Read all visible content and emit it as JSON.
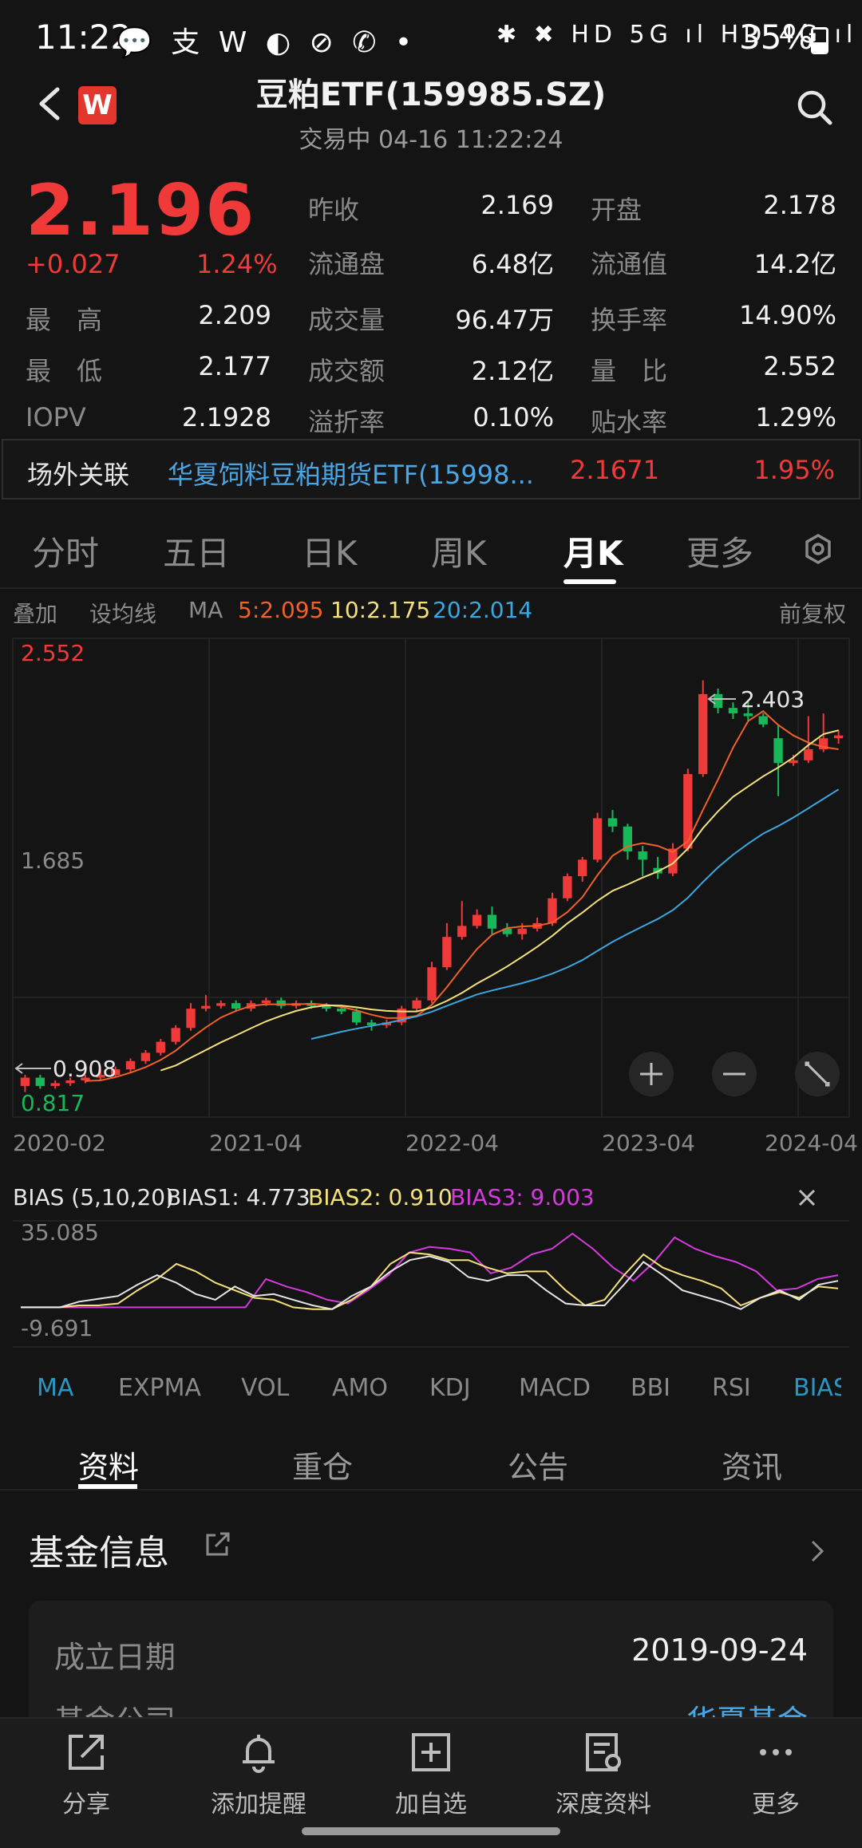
{
  "status_bar": {
    "time": "11:22",
    "left_icons": "💬 支 W ◐ ⊘ ✆ •",
    "right_icons": "✱ ✖ HD 5G ıl HD 4G ıl",
    "battery": "35%"
  },
  "header": {
    "logo_text": "W",
    "title": "豆粕ETF(159985.SZ)",
    "subtitle": "交易中 04-16 11:22:24"
  },
  "quote": {
    "price": "2.196",
    "change": "+0.027",
    "change_pct": "1.24%",
    "left_stats": [
      {
        "label": "最　高",
        "value": "2.209"
      },
      {
        "label": "最　低",
        "value": "2.177"
      },
      {
        "label": "IOPV",
        "value": "2.1928"
      }
    ],
    "mid_stats": [
      {
        "label": "昨收",
        "value": "2.169"
      },
      {
        "label": "流通盘",
        "value": "6.48亿"
      },
      {
        "label": "成交量",
        "value": "96.47万"
      },
      {
        "label": "成交额",
        "value": "2.12亿"
      },
      {
        "label": "溢折率",
        "value": "0.10%"
      }
    ],
    "right_stats": [
      {
        "label": "开盘",
        "value": "2.178"
      },
      {
        "label": "流通值",
        "value": "14.2亿"
      },
      {
        "label": "换手率",
        "value": "14.90%"
      },
      {
        "label": "量　比",
        "value": "2.552"
      },
      {
        "label": "贴水率",
        "value": "1.29%"
      }
    ]
  },
  "related": {
    "label": "场外关联",
    "name": "华夏饲料豆粕期货ETF(15998...",
    "price": "2.1671",
    "pct": "1.95%"
  },
  "period_tabs": [
    "分时",
    "五日",
    "日K",
    "周K",
    "月K",
    "更多"
  ],
  "period_active": "月K",
  "ma_row": {
    "overlay": "叠加",
    "set_ma": "设均线",
    "ma_label": "MA",
    "ma5": "5:2.095",
    "ma10": "10:2.175",
    "ma20": "20:2.014",
    "adjust": "前复权"
  },
  "chart_data": [
    {
      "type": "candlestick",
      "title": "",
      "ylim": [
        0.817,
        2.552
      ],
      "axis_labels": {
        "top": "2.552",
        "mid": "1.685",
        "bottom": "0.817"
      },
      "x_tick_labels": [
        "2020-02",
        "2021-04",
        "2022-04",
        "2023-04",
        "2024-04"
      ],
      "annotations": {
        "high": "2.403",
        "low": "0.908"
      },
      "colors": {
        "up": "#f03a3a",
        "down": "#18b85a",
        "ma5": "#f0602a",
        "ma10": "#f4e17a",
        "ma20": "#3aa8e0"
      },
      "candles": [
        {
          "o": 0.93,
          "c": 0.96,
          "h": 0.97,
          "l": 0.908
        },
        {
          "o": 0.96,
          "c": 0.93,
          "h": 0.97,
          "l": 0.92
        },
        {
          "o": 0.93,
          "c": 0.94,
          "h": 0.95,
          "l": 0.92
        },
        {
          "o": 0.94,
          "c": 0.95,
          "h": 0.96,
          "l": 0.93
        },
        {
          "o": 0.95,
          "c": 0.96,
          "h": 0.97,
          "l": 0.94
        },
        {
          "o": 0.96,
          "c": 0.97,
          "h": 0.99,
          "l": 0.95
        },
        {
          "o": 0.97,
          "c": 0.99,
          "h": 1.0,
          "l": 0.96
        },
        {
          "o": 0.99,
          "c": 1.02,
          "h": 1.03,
          "l": 0.98
        },
        {
          "o": 1.02,
          "c": 1.05,
          "h": 1.06,
          "l": 1.01
        },
        {
          "o": 1.05,
          "c": 1.09,
          "h": 1.1,
          "l": 1.04
        },
        {
          "o": 1.09,
          "c": 1.14,
          "h": 1.15,
          "l": 1.08
        },
        {
          "o": 1.14,
          "c": 1.21,
          "h": 1.23,
          "l": 1.13
        },
        {
          "o": 1.21,
          "c": 1.22,
          "h": 1.26,
          "l": 1.2
        },
        {
          "o": 1.22,
          "c": 1.23,
          "h": 1.24,
          "l": 1.21
        },
        {
          "o": 1.23,
          "c": 1.21,
          "h": 1.24,
          "l": 1.2
        },
        {
          "o": 1.21,
          "c": 1.23,
          "h": 1.24,
          "l": 1.2
        },
        {
          "o": 1.23,
          "c": 1.24,
          "h": 1.25,
          "l": 1.22
        },
        {
          "o": 1.24,
          "c": 1.22,
          "h": 1.25,
          "l": 1.21
        },
        {
          "o": 1.22,
          "c": 1.23,
          "h": 1.24,
          "l": 1.21
        },
        {
          "o": 1.23,
          "c": 1.22,
          "h": 1.24,
          "l": 1.21
        },
        {
          "o": 1.22,
          "c": 1.21,
          "h": 1.23,
          "l": 1.2
        },
        {
          "o": 1.21,
          "c": 1.2,
          "h": 1.22,
          "l": 1.19
        },
        {
          "o": 1.2,
          "c": 1.16,
          "h": 1.21,
          "l": 1.15
        },
        {
          "o": 1.16,
          "c": 1.15,
          "h": 1.17,
          "l": 1.13
        },
        {
          "o": 1.15,
          "c": 1.16,
          "h": 1.17,
          "l": 1.14
        },
        {
          "o": 1.16,
          "c": 1.21,
          "h": 1.22,
          "l": 1.15
        },
        {
          "o": 1.21,
          "c": 1.24,
          "h": 1.25,
          "l": 1.2
        },
        {
          "o": 1.24,
          "c": 1.36,
          "h": 1.38,
          "l": 1.23
        },
        {
          "o": 1.36,
          "c": 1.47,
          "h": 1.52,
          "l": 1.35
        },
        {
          "o": 1.47,
          "c": 1.51,
          "h": 1.6,
          "l": 1.46
        },
        {
          "o": 1.51,
          "c": 1.55,
          "h": 1.57,
          "l": 1.5
        },
        {
          "o": 1.55,
          "c": 1.5,
          "h": 1.58,
          "l": 1.48
        },
        {
          "o": 1.5,
          "c": 1.48,
          "h": 1.52,
          "l": 1.47
        },
        {
          "o": 1.48,
          "c": 1.5,
          "h": 1.52,
          "l": 1.46
        },
        {
          "o": 1.5,
          "c": 1.52,
          "h": 1.54,
          "l": 1.49
        },
        {
          "o": 1.52,
          "c": 1.61,
          "h": 1.63,
          "l": 1.51
        },
        {
          "o": 1.61,
          "c": 1.69,
          "h": 1.7,
          "l": 1.6
        },
        {
          "o": 1.69,
          "c": 1.75,
          "h": 1.76,
          "l": 1.67
        },
        {
          "o": 1.75,
          "c": 1.9,
          "h": 1.92,
          "l": 1.74
        },
        {
          "o": 1.9,
          "c": 1.87,
          "h": 1.93,
          "l": 1.85
        },
        {
          "o": 1.87,
          "c": 1.78,
          "h": 1.88,
          "l": 1.75
        },
        {
          "o": 1.78,
          "c": 1.75,
          "h": 1.8,
          "l": 1.69
        },
        {
          "o": 1.72,
          "c": 1.7,
          "h": 1.76,
          "l": 1.68
        },
        {
          "o": 1.7,
          "c": 1.79,
          "h": 1.81,
          "l": 1.69
        },
        {
          "o": 1.79,
          "c": 2.06,
          "h": 2.08,
          "l": 1.78
        },
        {
          "o": 2.06,
          "c": 2.35,
          "h": 2.4,
          "l": 2.05
        },
        {
          "o": 2.35,
          "c": 2.3,
          "h": 2.37,
          "l": 2.28
        },
        {
          "o": 2.3,
          "c": 2.28,
          "h": 2.32,
          "l": 2.26
        },
        {
          "o": 2.28,
          "c": 2.27,
          "h": 2.33,
          "l": 2.25
        },
        {
          "o": 2.27,
          "c": 2.24,
          "h": 2.28,
          "l": 2.23
        },
        {
          "o": 2.19,
          "c": 2.1,
          "h": 2.24,
          "l": 1.98
        },
        {
          "o": 2.1,
          "c": 2.11,
          "h": 2.13,
          "l": 2.09
        },
        {
          "o": 2.11,
          "c": 2.15,
          "h": 2.27,
          "l": 2.1
        },
        {
          "o": 2.15,
          "c": 2.19,
          "h": 2.28,
          "l": 2.14
        },
        {
          "o": 2.19,
          "c": 2.2,
          "h": 2.22,
          "l": 2.17
        }
      ]
    },
    {
      "type": "line",
      "title": "BIAS (5,10,20)",
      "ylim": [
        -9.691,
        35.085
      ],
      "axis_labels": {
        "top": "35.085",
        "bottom": "-9.691"
      },
      "legend": [
        {
          "name": "BIAS1: 4.773",
          "color": "#e6e6e6"
        },
        {
          "name": "BIAS2: 0.910",
          "color": "#f4e17a"
        },
        {
          "name": "BIAS3: 9.003",
          "color": "#d63adf"
        }
      ],
      "series": [
        {
          "name": "BIAS1",
          "color": "#e6e6e6",
          "values": [
            -9.0,
            -9.0,
            -9.0,
            -6.0,
            -4.5,
            -3.0,
            3.0,
            8.0,
            4.0,
            -2.0,
            -5.0,
            2.0,
            -3.0,
            -2.0,
            -5.0,
            -8.0,
            -10.0,
            -3.0,
            2.0,
            10.0,
            16.0,
            18.0,
            15.0,
            7.0,
            5.0,
            8.0,
            8.0,
            0.0,
            -7.0,
            -8.0,
            -8.0,
            3.0,
            15.0,
            8.0,
            0.0,
            -3.0,
            -6.0,
            -10.0,
            -4.0,
            0.0,
            -5.0,
            3.0,
            5.0
          ]
        },
        {
          "name": "BIAS2",
          "color": "#f4e17a",
          "values": [
            -9.0,
            -9.0,
            -9.0,
            -8.0,
            -8.0,
            -7.0,
            0.0,
            6.0,
            14.0,
            10.0,
            4.0,
            0.0,
            -4.0,
            -5.0,
            -9.0,
            -10.0,
            -10.0,
            -5.0,
            2.0,
            14.0,
            20.0,
            19.0,
            16.0,
            16.0,
            12.0,
            9.0,
            10.0,
            10.0,
            0.0,
            -8.0,
            -5.0,
            8.0,
            19.0,
            12.0,
            8.0,
            5.0,
            1.0,
            -8.0,
            -4.0,
            -1.0,
            -4.0,
            2.0,
            1.0
          ]
        },
        {
          "name": "BIAS3",
          "color": "#d63adf",
          "values": [
            -9.0,
            -9.0,
            -9.0,
            -9.0,
            -9.0,
            -9.0,
            -9.0,
            -9.0,
            -9.0,
            -9.0,
            -9.0,
            -9.0,
            6.0,
            2.0,
            -1.0,
            -5.0,
            -7.0,
            0.0,
            8.0,
            20.0,
            23.0,
            22.0,
            20.0,
            9.0,
            12.0,
            19.0,
            22.0,
            30.0,
            22.0,
            12.0,
            5.0,
            15.0,
            28.0,
            22.0,
            18.0,
            15.0,
            10.0,
            0.0,
            1.0,
            6.0,
            8.0
          ]
        }
      ]
    }
  ],
  "bias_row": {
    "name": "BIAS (5,10,20)",
    "b1": "BIAS1: 4.773",
    "b2": "BIAS2: 0.910",
    "b3": "BIAS3: 9.003"
  },
  "indicator_tabs": [
    "MA",
    "EXPMA",
    "VOL",
    "AMO",
    "KDJ",
    "MACD",
    "BBI",
    "RSI",
    "BIAS"
  ],
  "indicator_active": "MA",
  "content_tabs": [
    "资料",
    "重仓",
    "公告",
    "资讯"
  ],
  "content_active": "资料",
  "fund_info": {
    "title": "基金信息",
    "rows": [
      {
        "key": "成立日期",
        "value": "2019-09-24"
      },
      {
        "key": "基金公司",
        "value": "华夏基金"
      }
    ]
  },
  "bottom_bar": [
    {
      "label": "分享",
      "icon": "share-icon"
    },
    {
      "label": "添加提醒",
      "icon": "bell-icon"
    },
    {
      "label": "加自选",
      "icon": "add-watchlist-icon"
    },
    {
      "label": "深度资料",
      "icon": "document-icon"
    },
    {
      "label": "更多",
      "icon": "more-icon"
    }
  ]
}
